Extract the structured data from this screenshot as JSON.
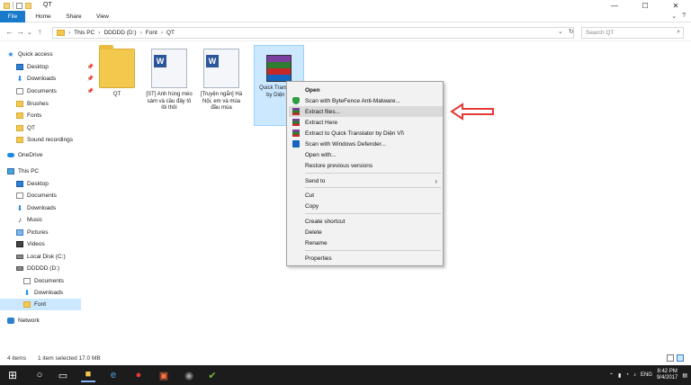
{
  "titlebar": {
    "title": "QT",
    "minimize": "—",
    "maximize": "☐",
    "close": "✕"
  },
  "ribbon": {
    "tabs": [
      "File",
      "Home",
      "Share",
      "View"
    ],
    "expand": "⌄",
    "help": "?"
  },
  "address": {
    "back": "←",
    "forward": "→",
    "up_history": "⌄",
    "up": "↑",
    "crumbs": [
      "This PC",
      "DDDDD (D:)",
      "Font",
      "QT"
    ],
    "crumb_sep": "›",
    "dropdown": "⌄",
    "refresh": "↻",
    "search_placeholder": "Search QT",
    "search_icon": "search-icon"
  },
  "sidebar": {
    "items": [
      {
        "label": "Quick access",
        "icon": "star-icon"
      },
      {
        "label": "Desktop",
        "icon": "desktop-icon"
      },
      {
        "label": "Downloads",
        "icon": "download-icon"
      },
      {
        "label": "Documents",
        "icon": "document-icon"
      },
      {
        "label": "Brushes",
        "icon": "folder-icon"
      },
      {
        "label": "Fonts",
        "icon": "folder-icon"
      },
      {
        "label": "QT",
        "icon": "folder-icon"
      },
      {
        "label": "Sound recordings",
        "icon": "folder-icon"
      },
      {
        "label": "OneDrive",
        "icon": "cloud-icon"
      },
      {
        "label": "This PC",
        "icon": "computer-icon"
      },
      {
        "label": "Desktop",
        "icon": "desktop-icon"
      },
      {
        "label": "Documents",
        "icon": "document-icon"
      },
      {
        "label": "Downloads",
        "icon": "download-icon"
      },
      {
        "label": "Music",
        "icon": "music-icon"
      },
      {
        "label": "Pictures",
        "icon": "pictures-icon"
      },
      {
        "label": "Videos",
        "icon": "videos-icon"
      },
      {
        "label": "Local Disk (C:)",
        "icon": "disk-icon"
      },
      {
        "label": "DDDDD (D:)",
        "icon": "disk-icon"
      },
      {
        "label": "Documents",
        "icon": "document-icon"
      },
      {
        "label": "Downloads",
        "icon": "download-icon"
      },
      {
        "label": "Font",
        "icon": "folder-icon"
      },
      {
        "label": "Network",
        "icon": "network-icon"
      }
    ],
    "pin": "📌"
  },
  "files": [
    {
      "name": "QT",
      "type": "folder"
    },
    {
      "name": "[ST] Anh hùng méo sám và cầu đây tô lôi thôi",
      "type": "word"
    },
    {
      "name": "[Truyện ngắn] Hà Nội, em và mùa đầu mùa",
      "type": "word"
    },
    {
      "name": "Quick Translator by Diện Vĩ",
      "type": "rar"
    }
  ],
  "context_menu": {
    "items": [
      {
        "label": "Open",
        "icon": ""
      },
      {
        "label": "Scan with ByteFence Anti-Malware...",
        "icon": "shield-icon"
      },
      {
        "label": "Extract files...",
        "icon": "winrar-icon"
      },
      {
        "label": "Extract Here",
        "icon": "winrar-icon"
      },
      {
        "label": "Extract to Quick Translator by Diện Vĩ\\",
        "icon": "winrar-icon"
      },
      {
        "label": "Scan with Windows Defender...",
        "icon": "defender-icon"
      },
      {
        "label": "Open with...",
        "icon": ""
      },
      {
        "label": "Restore previous versions",
        "icon": ""
      },
      {
        "label": "Send to",
        "icon": ""
      },
      {
        "label": "Cut",
        "icon": ""
      },
      {
        "label": "Copy",
        "icon": ""
      },
      {
        "label": "Create shortcut",
        "icon": ""
      },
      {
        "label": "Delete",
        "icon": ""
      },
      {
        "label": "Rename",
        "icon": ""
      },
      {
        "label": "Properties",
        "icon": ""
      }
    ],
    "submenu_arrow": "›"
  },
  "status": {
    "count": "4 items",
    "selected": "1 item selected  17.0 MB"
  },
  "taskbar": {
    "start": "⊞",
    "apps": [
      "search-icon",
      "task-view-icon",
      "explorer-icon",
      "edge-icon",
      "chrome-icon",
      "onenote-icon",
      "store-icon",
      "checkmark-icon"
    ],
    "tray_lang": "ENG",
    "time": "8:42 PM",
    "date": "9/4/2017"
  },
  "colors": {
    "accent": "#1979ca",
    "selection": "#cce8ff",
    "annotation_arrow": "#e53935"
  }
}
